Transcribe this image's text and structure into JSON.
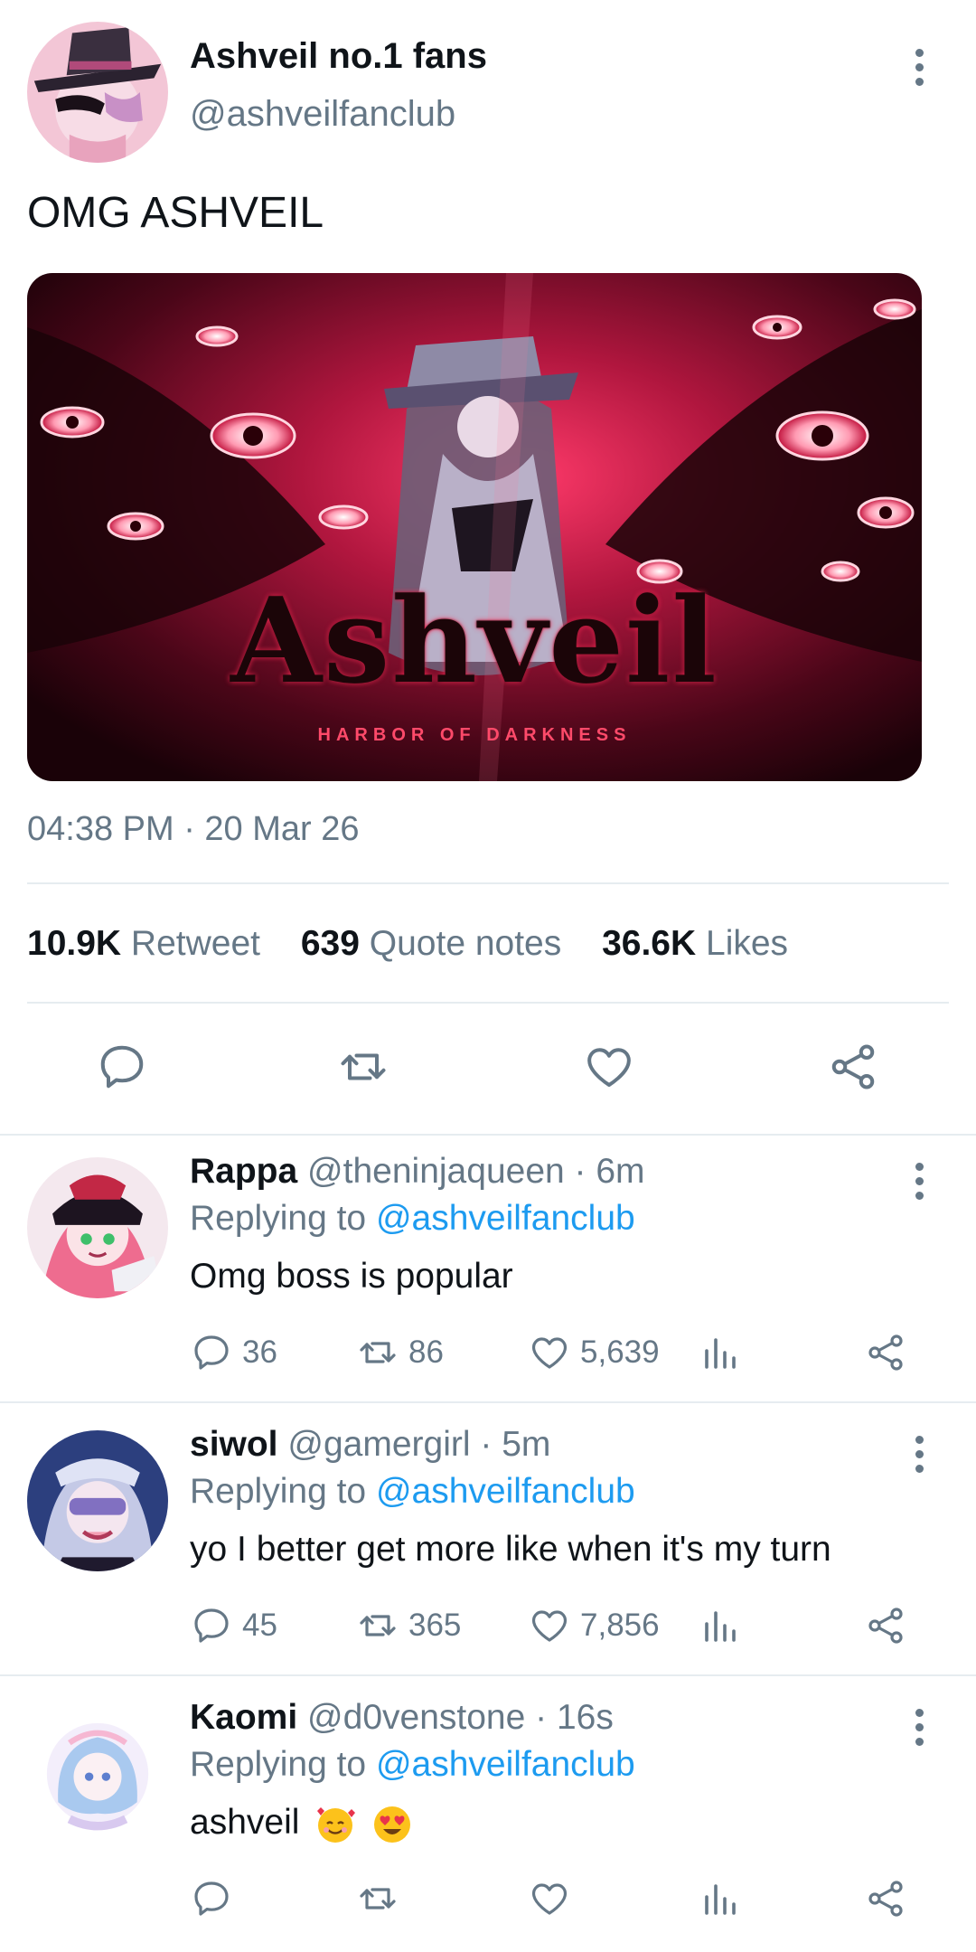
{
  "post": {
    "display_name": "Ashveil no.1 fans",
    "handle": "@ashveilfanclub",
    "text": "OMG ASHVEIL",
    "media": {
      "title": "Ashveil",
      "subtitle": "HARBOR OF DARKNESS"
    },
    "timestamp": "04:38 PM · 20 Mar 26",
    "stats": [
      {
        "count": "10.9K",
        "label": "Retweet"
      },
      {
        "count": "639",
        "label": "Quote notes"
      },
      {
        "count": "36.6K",
        "label": "Likes"
      }
    ],
    "actions": [
      "reply-icon",
      "retweet-icon",
      "like-icon",
      "share-icon"
    ]
  },
  "replies": [
    {
      "name": "Rappa",
      "handle": "@theninjaqueen",
      "time": "· 6m",
      "replying_prefix": "Replying to ",
      "replying_to": "@ashveilfanclub",
      "text": "Omg boss is popular",
      "reply_count": "36",
      "retweet_count": "86",
      "like_count": "5,639",
      "avatar_colors": [
        "#e8557a",
        "#2a1a2e",
        "#f7b6c8"
      ]
    },
    {
      "name": "siwol",
      "handle": "@gamergirl",
      "time": "· 5m",
      "replying_prefix": "Replying to ",
      "replying_to": "@ashveilfanclub",
      "text": "yo I better get more like when it's my turn",
      "reply_count": "45",
      "retweet_count": "365",
      "like_count": "7,856",
      "avatar_colors": [
        "#3d5ba8",
        "#c9cde8",
        "#8f7fd6"
      ]
    },
    {
      "name": "Kaomi",
      "handle": "@d0venstone",
      "time": "· 16s",
      "replying_prefix": "Replying to ",
      "replying_to": "@ashveilfanclub",
      "text": "ashveil",
      "reply_count": "",
      "retweet_count": "",
      "like_count": "",
      "avatar_colors": [
        "#a7c8f0",
        "#f4eefc",
        "#7fa8e0"
      ]
    }
  ],
  "colors": {
    "text_primary": "#0f1419",
    "text_secondary": "#657786",
    "link": "#1d9bf0",
    "divider": "#e6ecf0"
  }
}
